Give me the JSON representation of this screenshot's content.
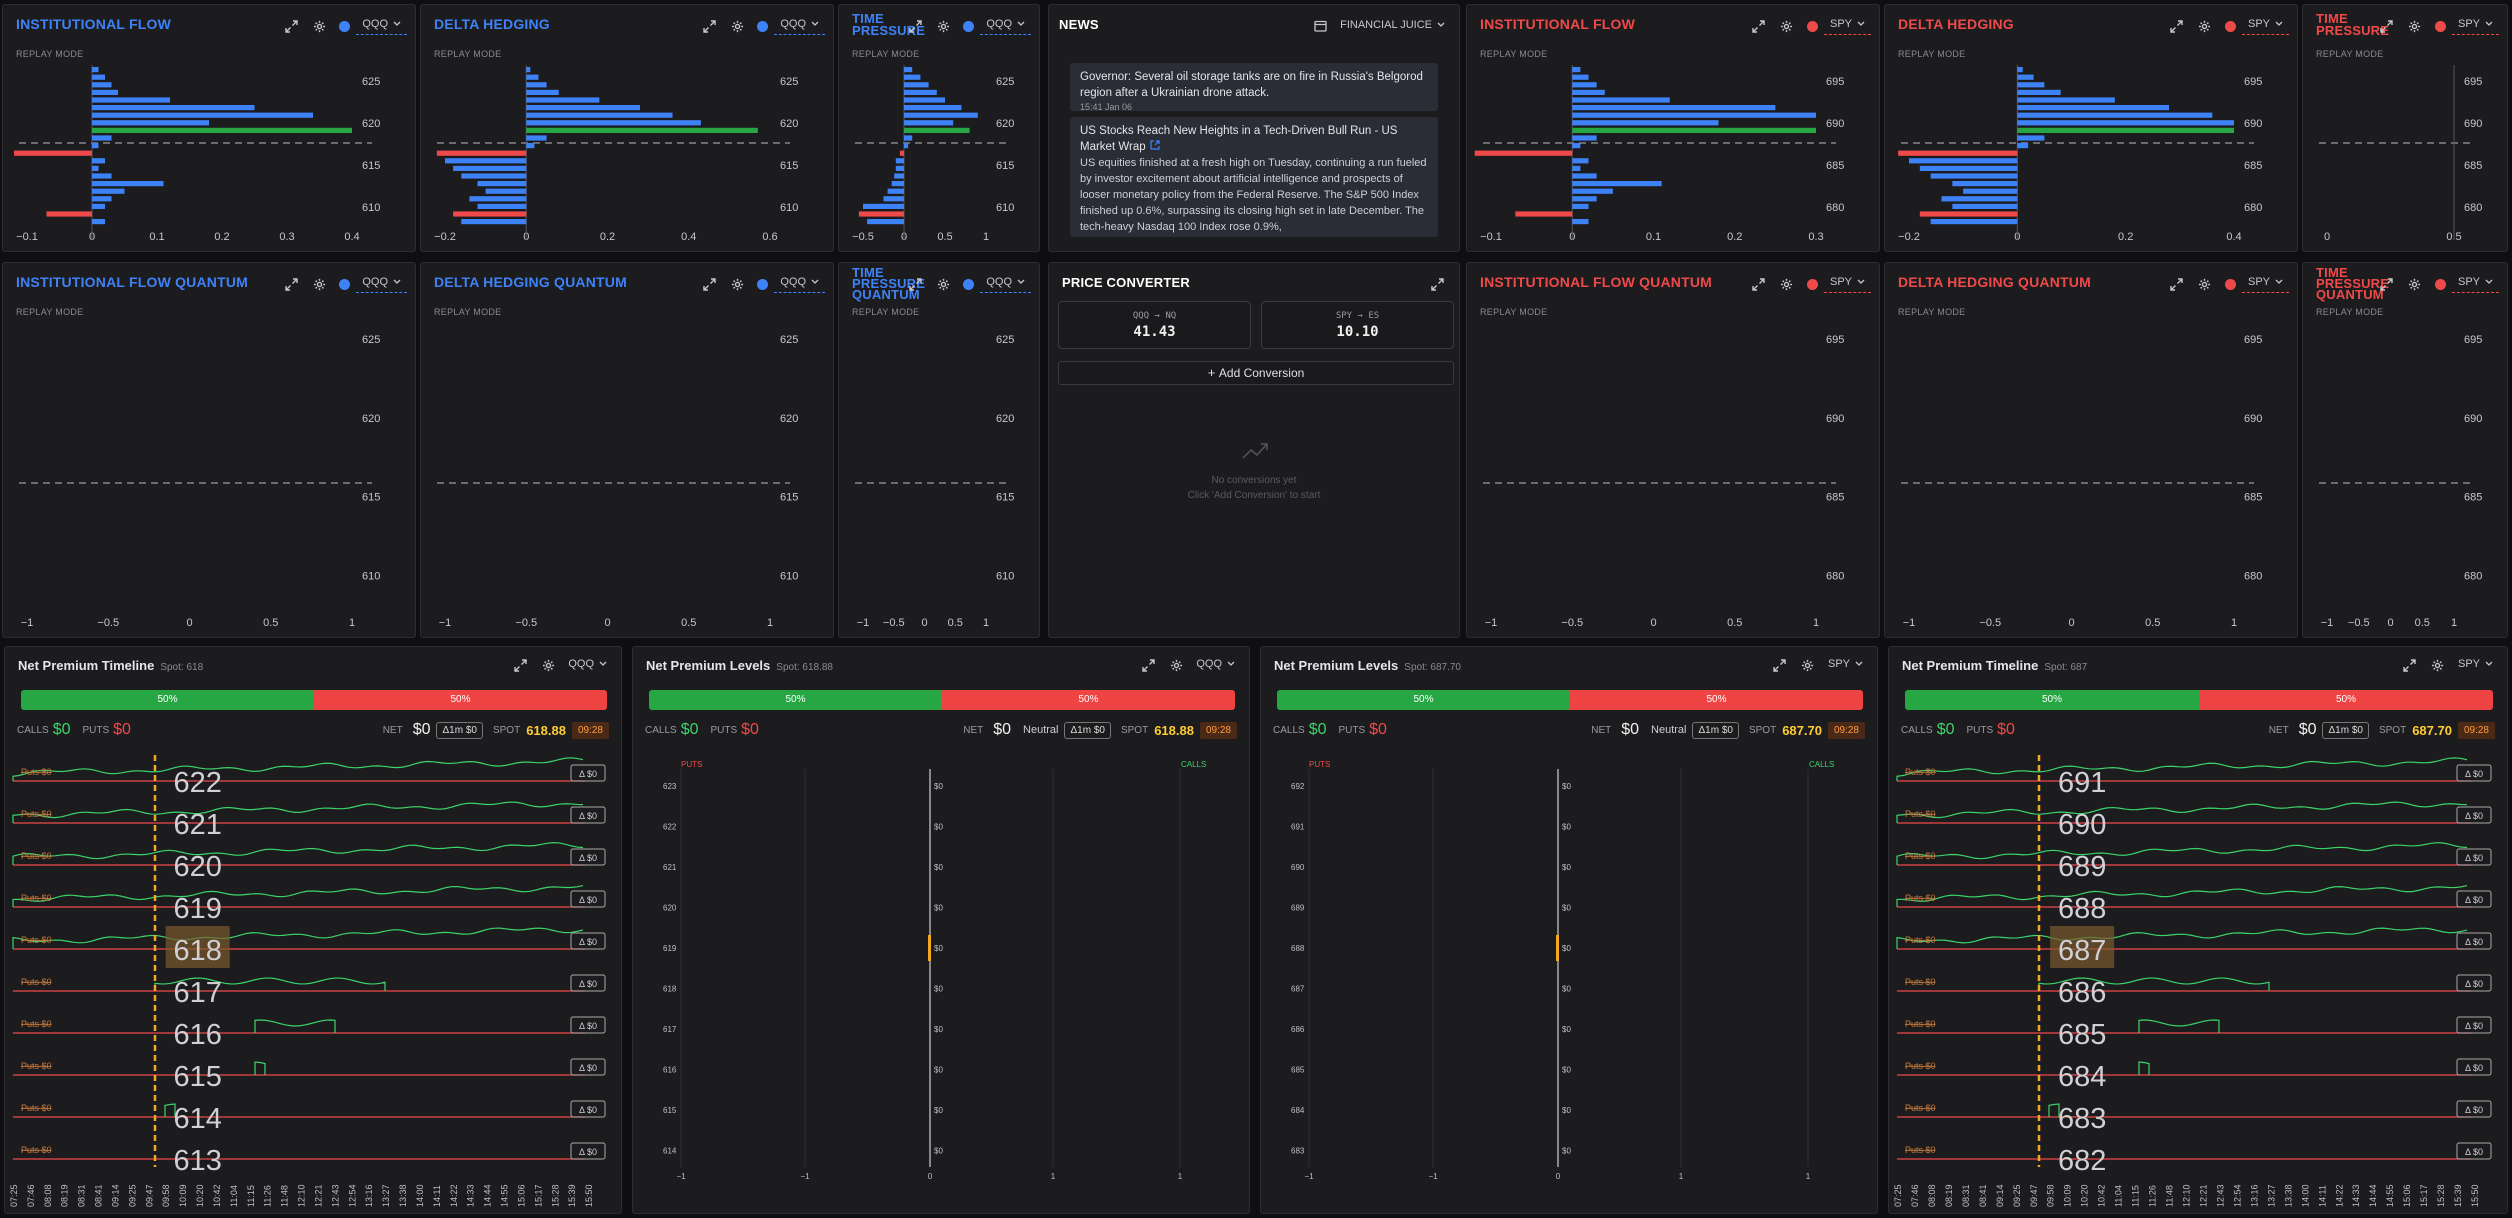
{
  "common": {
    "replay": "REPLAY MODE",
    "expand": "expand-icon",
    "gear": "gear-icon"
  },
  "colors": {
    "blue": "#3e82f7",
    "red": "#ef4949",
    "green": "#27a744",
    "orange": "#f5a623"
  },
  "flow_panels": [
    {
      "title": "INSTITUTIONAL FLOW",
      "color": "blue",
      "ticker": "QQQ",
      "levels": [
        "625",
        "620",
        "615",
        "610"
      ],
      "xticks": [
        "−0.1",
        "0",
        "0.1",
        "0.2",
        "0.3",
        "0.4"
      ]
    },
    {
      "title": "DELTA HEDGING",
      "color": "blue",
      "ticker": "QQQ",
      "levels": [
        "625",
        "620",
        "615",
        "610"
      ],
      "xticks": [
        "−0.2",
        "0",
        "0.2",
        "0.4",
        "0.6"
      ]
    },
    {
      "title": "TIME PRESSURE",
      "color": "blue",
      "ticker": "QQQ",
      "levels": [
        "625",
        "620",
        "615",
        "610"
      ],
      "xticks": [
        "−0.5",
        "0",
        "0.5",
        "1"
      ]
    },
    {
      "title": "INSTITUTIONAL FLOW",
      "color": "red",
      "ticker": "SPY",
      "levels": [
        "695",
        "690",
        "685",
        "680"
      ],
      "xticks": [
        "−0.1",
        "0",
        "0.1",
        "0.2",
        "0.3"
      ]
    },
    {
      "title": "DELTA HEDGING",
      "color": "red",
      "ticker": "SPY",
      "levels": [
        "695",
        "690",
        "685",
        "680"
      ],
      "xticks": [
        "−0.2",
        "0",
        "0.2",
        "0.4"
      ]
    },
    {
      "title": "TIME PRESSURE",
      "color": "red",
      "ticker": "SPY",
      "levels": [
        "695",
        "690",
        "685",
        "680"
      ],
      "xticks": [
        "0",
        "0.5"
      ]
    },
    {
      "title": "INSTITUTIONAL FLOW QUANTUM",
      "color": "blue",
      "ticker": "QQQ",
      "levels": [
        "625",
        "620",
        "615",
        "610"
      ],
      "xticks": [
        "−1",
        "−0.5",
        "0",
        "0.5",
        "1"
      ]
    },
    {
      "title": "DELTA HEDGING QUANTUM",
      "color": "blue",
      "ticker": "QQQ",
      "levels": [
        "625",
        "620",
        "615",
        "610"
      ],
      "xticks": [
        "−1",
        "−0.5",
        "0",
        "0.5",
        "1"
      ]
    },
    {
      "title": "TIME PRESSURE QUANTUM",
      "color": "blue",
      "ticker": "QQQ",
      "levels": [
        "625",
        "620",
        "615",
        "610"
      ],
      "xticks": [
        "−1",
        "−0.5",
        "0",
        "0.5",
        "1"
      ]
    },
    {
      "title": "INSTITUTIONAL FLOW QUANTUM",
      "color": "red",
      "ticker": "SPY",
      "levels": [
        "695",
        "690",
        "685",
        "680"
      ],
      "xticks": [
        "−1",
        "−0.5",
        "0",
        "0.5",
        "1"
      ]
    },
    {
      "title": "DELTA HEDGING QUANTUM",
      "color": "red",
      "ticker": "SPY",
      "levels": [
        "695",
        "690",
        "685",
        "680"
      ],
      "xticks": [
        "−1",
        "−0.5",
        "0",
        "0.5",
        "1"
      ]
    },
    {
      "title": "TIME PRESSURE QUANTUM",
      "color": "red",
      "ticker": "SPY",
      "levels": [
        "695",
        "690",
        "685",
        "680"
      ],
      "xticks": [
        "−1",
        "−0.5",
        "0",
        "0.5",
        "1"
      ]
    }
  ],
  "news": {
    "title": "NEWS",
    "source": "FINANCIAL JUICE",
    "calendar_icon": "calendar-icon",
    "items": [
      {
        "text": "Governor: Several oil storage tanks are on fire in Russia's Belgorod region after a Ukrainian drone attack.",
        "time": "15:41 Jan 06"
      },
      {
        "headline": "US Stocks Reach New Heights in a Tech-Driven Bull Run - US Market Wrap",
        "body": "US equities finished at a fresh high on Tuesday, continuing a run fueled by investor excitement about artificial intelligence and prospects of looser monetary policy from the Federal Reserve. The S&P 500 Index finished up 0.6%, surpassing its closing high set in late December. The tech-heavy Nasdaq 100 Index rose 0.9%,"
      }
    ]
  },
  "converter": {
    "title": "PRICE CONVERTER",
    "cards": [
      {
        "label": "QQQ → NQ",
        "value": "41.43"
      },
      {
        "label": "SPY → ES",
        "value": "10.10"
      }
    ],
    "add": "Add Conversion",
    "empty1": "No conversions yet",
    "empty2": "Click 'Add Conversion' to start"
  },
  "bottom": [
    {
      "title": "Net Premium Timeline",
      "spot_label": "Spot: 618",
      "ticker": "QQQ",
      "green": "50%",
      "red": "50%",
      "calls": "$0",
      "puts": "$0",
      "net": "$0",
      "delta": "Δ1m $0",
      "spot": "618.88",
      "time": "09:28",
      "levels": [
        "622",
        "621",
        "620",
        "619",
        "618",
        "617",
        "616",
        "615",
        "614",
        "613"
      ],
      "highlight": "618"
    },
    {
      "title": "Net Premium Levels",
      "spot_label": "Spot: 618.88",
      "ticker": "QQQ",
      "green": "50%",
      "red": "50%",
      "calls": "$0",
      "puts": "$0",
      "net": "$0",
      "sentiment": "Neutral",
      "delta": "Δ1m $0",
      "spot": "618.88",
      "time": "09:28",
      "levels": [
        "623",
        "622",
        "621",
        "620",
        "619",
        "618",
        "617",
        "616",
        "615",
        "614"
      ],
      "puts_lbl": "PUTS",
      "calls_lbl": "CALLS",
      "xticks": [
        "−1",
        "−1",
        "0",
        "1",
        "1"
      ]
    },
    {
      "title": "Net Premium Levels",
      "spot_label": "Spot: 687.70",
      "ticker": "SPY",
      "green": "50%",
      "red": "50%",
      "calls": "$0",
      "puts": "$0",
      "net": "$0",
      "sentiment": "Neutral",
      "delta": "Δ1m $0",
      "spot": "687.70",
      "time": "09:28",
      "levels": [
        "692",
        "691",
        "690",
        "689",
        "688",
        "687",
        "686",
        "685",
        "684",
        "683"
      ],
      "puts_lbl": "PUTS",
      "calls_lbl": "CALLS",
      "xticks": [
        "−1",
        "−1",
        "0",
        "1",
        "1"
      ]
    },
    {
      "title": "Net Premium Timeline",
      "spot_label": "Spot: 687",
      "ticker": "SPY",
      "green": "50%",
      "red": "50%",
      "calls": "$0",
      "puts": "$0",
      "net": "$0",
      "delta": "Δ1m $0",
      "spot": "687.70",
      "time": "09:28",
      "levels": [
        "691",
        "690",
        "689",
        "688",
        "687",
        "686",
        "685",
        "684",
        "683",
        "682"
      ],
      "highlight": "687"
    }
  ],
  "timeline_labels": {
    "calls": "CALLS",
    "puts": "PUTS",
    "net": "NET",
    "spot": "SPOT",
    "row_left": "Puts $0",
    "row_right": "Δ $0",
    "zero": "$0"
  },
  "time_axis": [
    "07:25",
    "07:46",
    "08:08",
    "08:19",
    "08:31",
    "08:41",
    "09:14",
    "09:25",
    "09:47",
    "09:58",
    "10:09",
    "10:20",
    "10:42",
    "11:04",
    "11:15",
    "11:26",
    "11:48",
    "12:10",
    "12:21",
    "12:43",
    "12:54",
    "13:16",
    "13:27",
    "13:38",
    "14:00",
    "14:11",
    "14:22",
    "14:33",
    "14:44",
    "14:55",
    "15:06",
    "15:17",
    "15:28",
    "15:39",
    "15:50"
  ]
}
